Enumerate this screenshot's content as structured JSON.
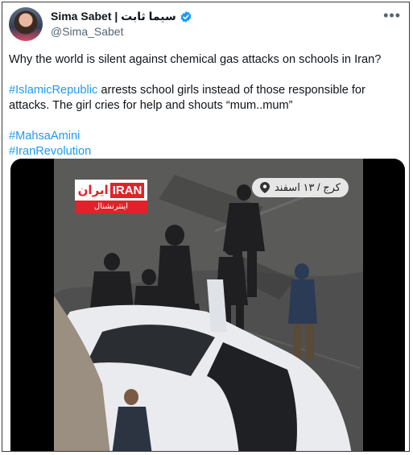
{
  "author": {
    "name": "Sima Sabet | سیما ثابت",
    "handle": "@Sima_Sabet"
  },
  "menu": {
    "more_label": "•••"
  },
  "tweet": {
    "line1": "Why the world is silent against chemical gas attacks on schools in Iran?",
    "hashtag_islamic": "#IslamicRepublic",
    "line2_rest": " arrests school girls instead of those responsible for attacks. The girl cries for help and shouts “mum..mum”",
    "hashtag_mahsa": "#MahsaAmini",
    "hashtag_iran": "#IranRevolution"
  },
  "video": {
    "logo_primary": "IRAN",
    "logo_secondary": "ایران",
    "logo_sub": "اینترنشنال",
    "location": "کرج / ۱۳ اسفند"
  },
  "colors": {
    "link": "#1d9bf0",
    "verified": "#1d9bf0",
    "brand_red": "#e0222a"
  }
}
